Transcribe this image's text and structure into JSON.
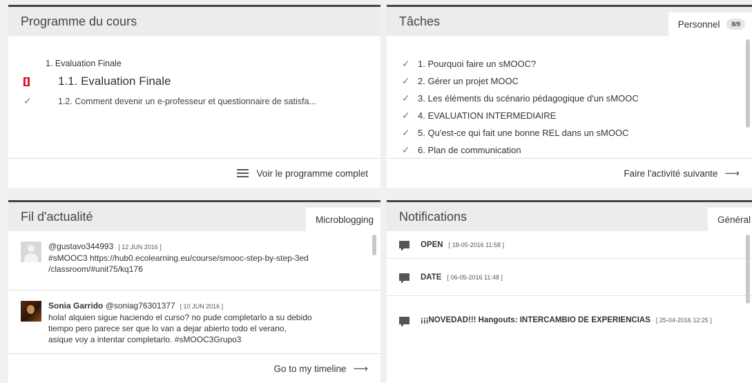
{
  "programme": {
    "title": "Programme du cours",
    "section": "1. Evaluation Finale",
    "items": [
      {
        "label": "1.1. Evaluation Finale",
        "icon": "bookmark-icon"
      },
      {
        "label": "1.2. Comment devenir un e-professeur et questionnaire de satisfa...",
        "icon": "check-icon"
      }
    ],
    "footer_link": "Voir le programme complet"
  },
  "taches": {
    "title": "Tâches",
    "tab_label": "Personnel",
    "badge": "8/9",
    "items": [
      "1. Pourquoi faire un sMOOC?",
      "2. Gérer un projet MOOC",
      "3. Les éléments du scénario pédagogique d'un sMOOC",
      "4. EVALUATION INTERMEDIAIRE",
      "5. Qu'est-ce qui fait une bonne REL dans un sMOOC",
      "6. Plan de communication"
    ],
    "footer_link": "Faire l'activité suivante"
  },
  "fil": {
    "title": "Fil d'actualité",
    "tab_label": "Microblogging",
    "posts": [
      {
        "name": "",
        "handle": "@gustavo344993",
        "date": "[ 12 JUN 2016 ]",
        "lines": [
          "#sMOOC3 https://hub0.ecolearning.eu/course/smooc-step-by-step-3ed",
          "/classroom/#unit75/kq176"
        ]
      },
      {
        "name": "Sonia Garrido",
        "handle": "@soniag76301377",
        "date": "[ 10 JUN 2016 ]",
        "lines": [
          "hola! alquien sigue haciendo el curso? no pude completarlo a su debido",
          "tiempo pero parece ser que lo van a dejar abierto todo el verano,",
          "asique voy a intentar completarlo. #sMOOC3Grupo3"
        ]
      }
    ],
    "footer_link": "Go to my timeline"
  },
  "notifications": {
    "title": "Notifications",
    "tab_label": "Général",
    "items": [
      {
        "title": "OPEN",
        "date": "[ 18-05-2016 11:58 ]"
      },
      {
        "title": "DATE",
        "date": "[ 06-05-2016 11:48 ]"
      },
      {
        "title": "¡¡¡NOVEDAD!!! Hangouts: INTERCAMBIO DE EXPERIENCIAS",
        "date": "[ 25-04-2016 12:25 ]"
      }
    ]
  }
}
